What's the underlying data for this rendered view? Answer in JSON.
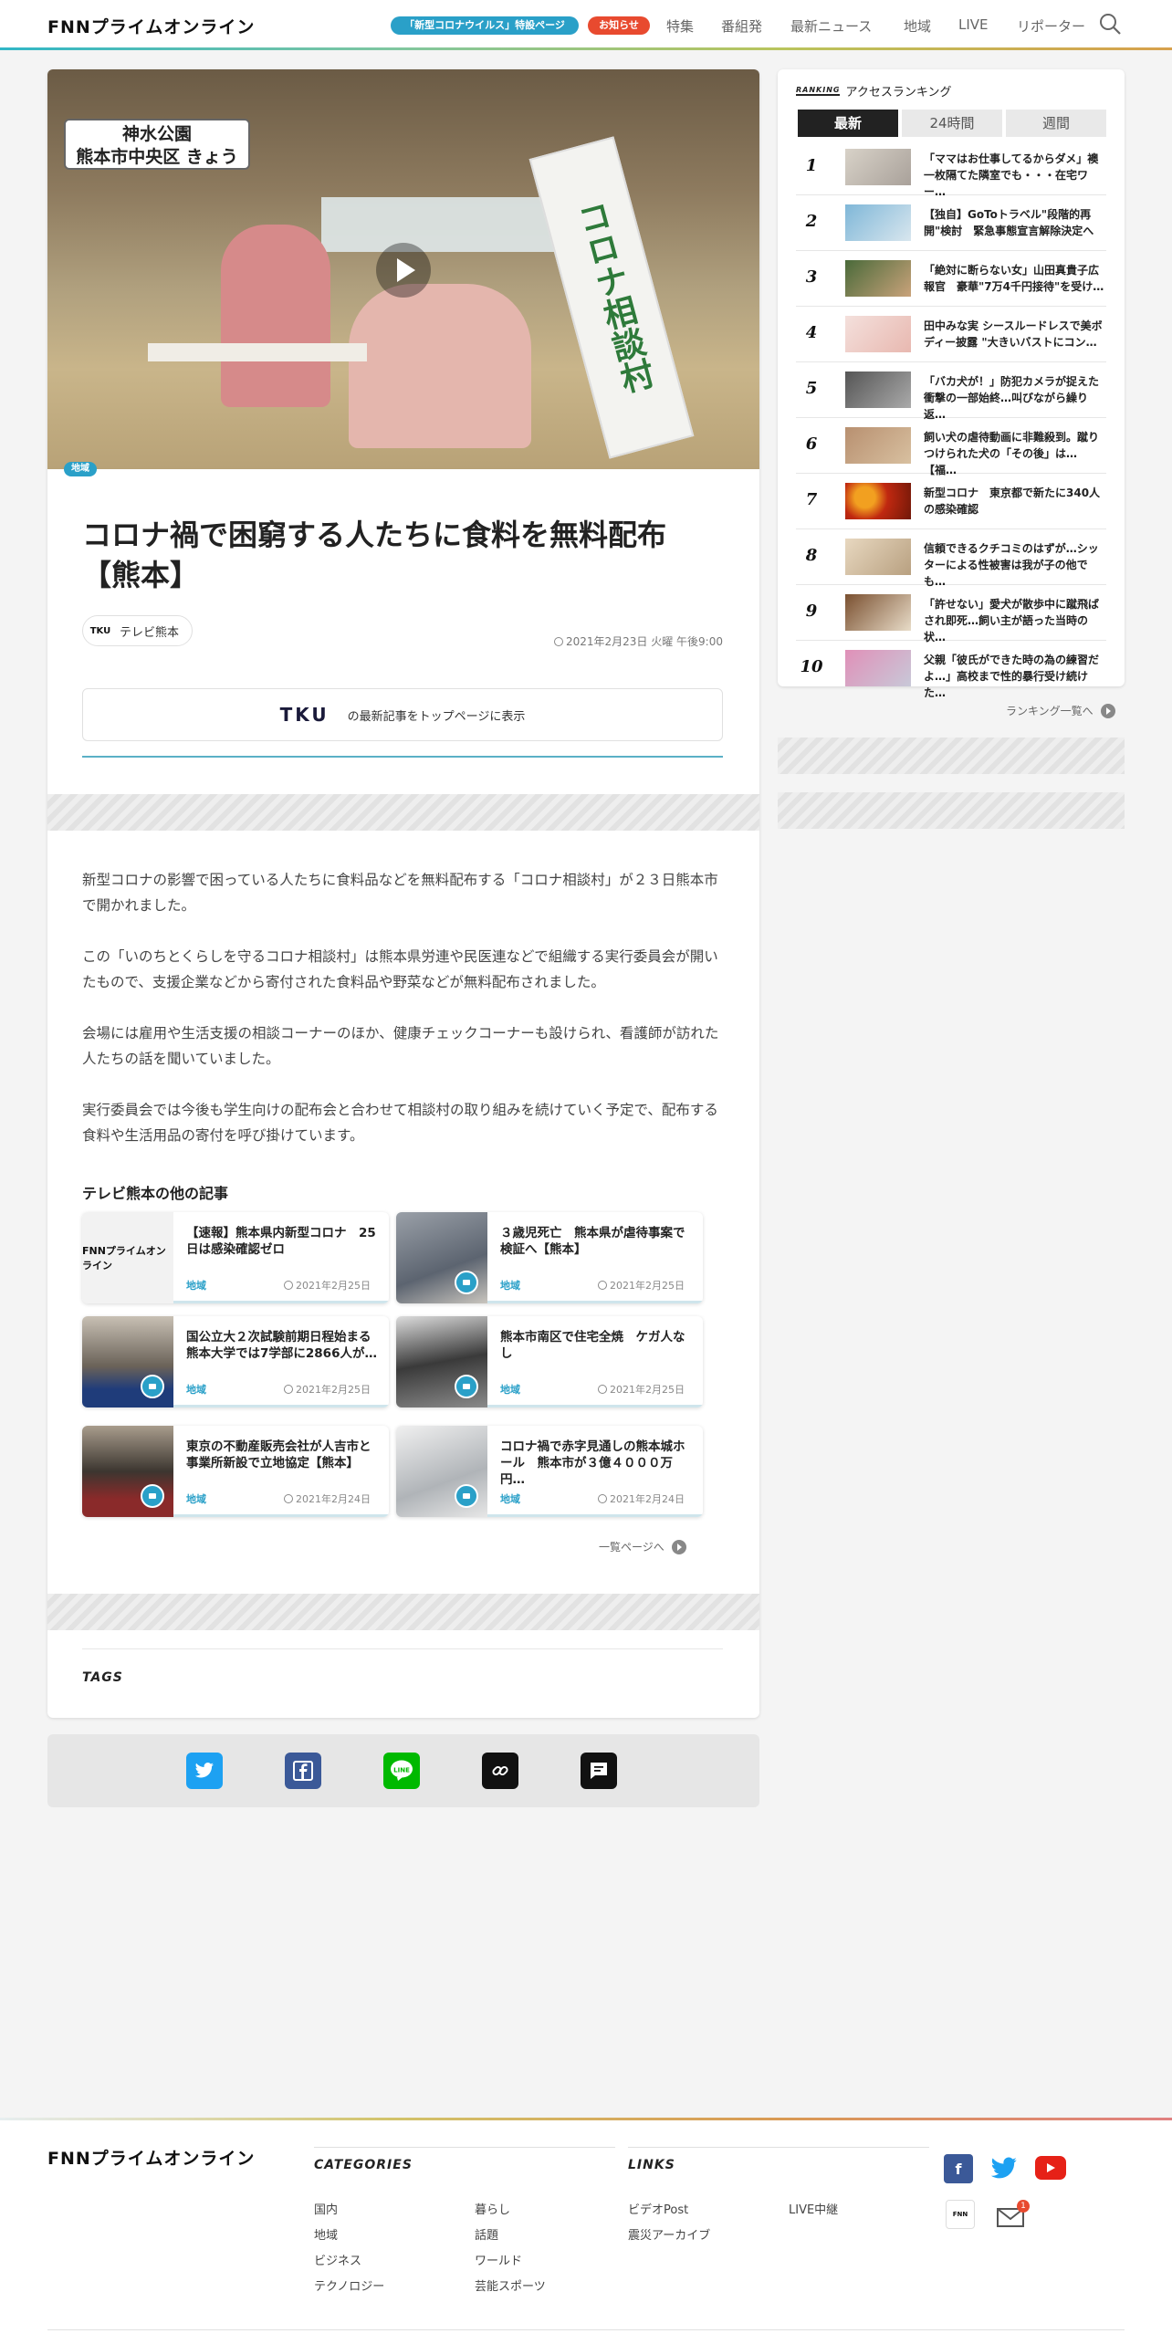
{
  "header": {
    "logo": "FNNプライムオンライン",
    "pill_corona": "「新型コロナウイルス」特設ページ",
    "pill_notice": "お知らせ",
    "nav": [
      "特集",
      "番組発",
      "最新ニュース",
      "地域",
      "LIVE",
      "リポーター"
    ]
  },
  "article": {
    "hero_caption_line1": "神水公園",
    "hero_caption_line2": "熊本市中央区 きょう",
    "hero_banner": "コロナ相談村",
    "category": "地域",
    "title": "コロナ禍で困窮する人たちに食料を無料配布【熊本】",
    "source": "テレビ熊本",
    "source_mini": "TKU",
    "date": "2021年2月23日 火曜 午後9:00",
    "tku_logo": "TKU",
    "tku_link": "の最新記事をトップページに表示",
    "paragraphs": [
      "新型コロナの影響で困っている人たちに食料品などを無料配布する「コロナ相談村」が２３日熊本市で開かれました。",
      "この「いのちとくらしを守るコロナ相談村」は熊本県労連や民医連などで組織する実行委員会が開いたもので、支援企業などから寄付された食料品や野菜などが無料配布されました。",
      "会場には雇用や生活支援の相談コーナーのほか、健康チェックコーナーも設けられ、看護師が訪れた人たちの話を聞いていました。",
      "実行委員会では今後も学生向けの配布会と合わせて相談村の取り組みを続けていく予定で、配布する食料や生活用品の寄付を呼び掛けています。"
    ],
    "related_title": "テレビ熊本の他の記事",
    "related": [
      {
        "title": "【速報】熊本県内新型コロナ　25日は感染確認ゼロ",
        "tag": "地域",
        "date": "2021年2月25日"
      },
      {
        "title": "３歳児死亡　熊本県が虐待事案で検証へ【熊本】",
        "tag": "地域",
        "date": "2021年2月25日"
      },
      {
        "title": "国公立大２次試験前期日程始まる　熊本大学では7学部に2866人が…",
        "tag": "地域",
        "date": "2021年2月25日"
      },
      {
        "title": "熊本市南区で住宅全焼　ケガ人なし",
        "tag": "地域",
        "date": "2021年2月25日"
      },
      {
        "title": "東京の不動産販売会社が人吉市と事業所新設で立地協定【熊本】",
        "tag": "地域",
        "date": "2021年2月24日"
      },
      {
        "title": "コロナ禍で赤字見通しの熊本城ホール　熊本市が３億４０００万円…",
        "tag": "地域",
        "date": "2021年2月24日"
      }
    ],
    "more_label": "一覧ページへ",
    "tags_title": "TAGS"
  },
  "ranking": {
    "logo": "RANKING",
    "header": "アクセスランキング",
    "tabs": [
      "最新",
      "24時間",
      "週間"
    ],
    "items": [
      {
        "num": "1",
        "title": "「ママはお仕事してるからダメ」襖一枚隔てた隣室でも・・・在宅ワー…"
      },
      {
        "num": "2",
        "title": "【独自】GoToトラベル\"段階的再開\"検討　緊急事態宣言解除決定へ"
      },
      {
        "num": "3",
        "title": "「絶対に断らない女」山田真貴子広報官　豪華\"7万4千円接待\"を受け…"
      },
      {
        "num": "4",
        "title": "田中みな実 シースルードレスで美ボディー披露 \"大きいバストにコン…"
      },
      {
        "num": "5",
        "title": "「バカ犬が！」防犯カメラが捉えた衝撃の一部始終…叫びながら繰り返…"
      },
      {
        "num": "6",
        "title": "飼い犬の虐待動画に非難殺到。蹴りつけられた犬の「その後」は…【福…"
      },
      {
        "num": "7",
        "title": "新型コロナ　東京都で新たに340人の感染確認"
      },
      {
        "num": "8",
        "title": "信頼できるクチコミのはずが…シッターによる性被害は我が子の他でも…"
      },
      {
        "num": "9",
        "title": "「許せない」愛犬が散歩中に蹴飛ばされ即死…飼い主が語った当時の状…"
      },
      {
        "num": "10",
        "title": "父親「彼氏ができた時の為の練習だよ…」高校まで性的暴行受け続けた…"
      }
    ],
    "more_label": "ランキング一覧へ"
  },
  "footer": {
    "logo": "FNNプライムオンライン",
    "categories_title": "CATEGORIES",
    "categories": [
      "国内",
      "暮らし",
      "地域",
      "話題",
      "ビジネス",
      "ワールド",
      "テクノロジー",
      "芸能スポーツ"
    ],
    "links_title": "LINKS",
    "links": [
      "ビデオPost",
      "LIVE中継",
      "震災アーカイブ"
    ],
    "mail_badge": "1"
  }
}
